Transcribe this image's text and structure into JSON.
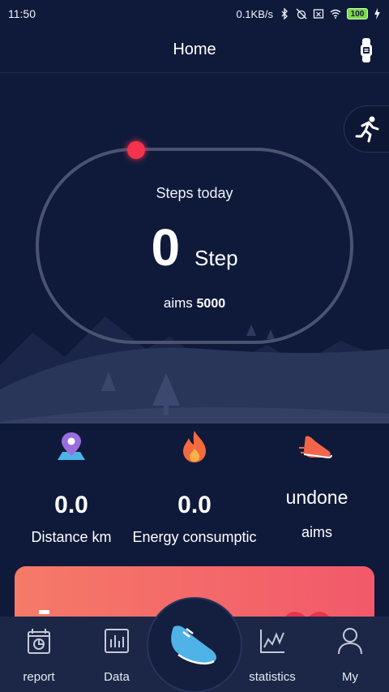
{
  "status_bar": {
    "time": "11:50",
    "network_speed": "0.1KB/s",
    "battery": "100",
    "icons": [
      "bluetooth-icon",
      "alarm-off-icon",
      "sim-icon",
      "wifi-icon",
      "battery-icon",
      "charging-icon"
    ]
  },
  "header": {
    "title": "Home",
    "band_icon": "band-icon"
  },
  "quick_action": {
    "icon": "running-icon"
  },
  "steps": {
    "label": "Steps today",
    "value": "0",
    "unit": "Step",
    "aims_label": "aims",
    "aims_value": "5000",
    "progress": 0
  },
  "metrics": [
    {
      "icon": "map-pin-icon",
      "value": "0.0",
      "label": "Distance km"
    },
    {
      "icon": "flame-icon",
      "value": "0.0",
      "label": "Energy consumptic"
    },
    {
      "icon": "shoe-icon",
      "value": "undone",
      "label": "aims"
    }
  ],
  "tabs": [
    {
      "icon": "report-icon",
      "label": "report"
    },
    {
      "icon": "data-icon",
      "label": "Data"
    },
    {
      "icon": "sneaker-icon",
      "label": ""
    },
    {
      "icon": "statistics-icon",
      "label": "statistics"
    },
    {
      "icon": "user-icon",
      "label": "My"
    }
  ],
  "colors": {
    "background": "#0f1a3a",
    "accent_red": "#f5334c",
    "card_gradient_start": "#f57a68",
    "card_gradient_end": "#f2596a",
    "tab_accent": "#4fb3e8"
  }
}
